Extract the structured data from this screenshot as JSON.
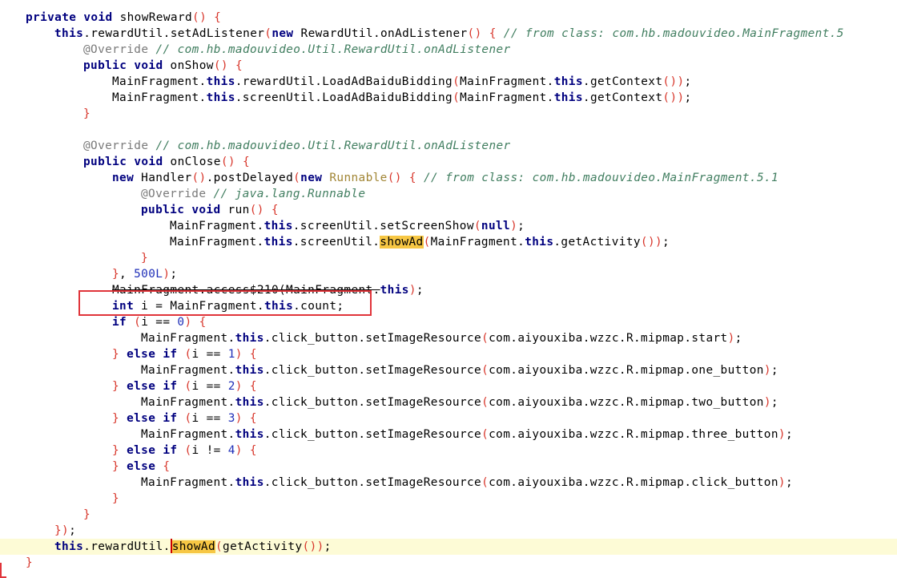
{
  "editor": {
    "lines": [
      [
        [
          "kw",
          "private"
        ],
        [
          "t",
          " "
        ],
        [
          "kw",
          "void"
        ],
        [
          "t",
          " showReward"
        ],
        [
          "p",
          "("
        ],
        [
          "p",
          ")"
        ],
        [
          "t",
          " "
        ],
        [
          "p",
          "{"
        ]
      ],
      [
        [
          "kw",
          "this"
        ],
        [
          "t",
          ".rewardUtil.setAdListener"
        ],
        [
          "p",
          "("
        ],
        [
          "kw",
          "new"
        ],
        [
          "t",
          " RewardUtil.onAdListener"
        ],
        [
          "p",
          "("
        ],
        [
          "p",
          ")"
        ],
        [
          "t",
          " "
        ],
        [
          "p",
          "{"
        ],
        [
          "t",
          " "
        ],
        [
          "cm",
          "// from class: com.hb.madouvideo.MainFragment.5"
        ]
      ],
      [
        [
          "an",
          "@Override"
        ],
        [
          "t",
          " "
        ],
        [
          "cm",
          "// com.hb.madouvideo.Util.RewardUtil.onAdListener"
        ]
      ],
      [
        [
          "kw",
          "public"
        ],
        [
          "t",
          " "
        ],
        [
          "kw",
          "void"
        ],
        [
          "t",
          " onShow"
        ],
        [
          "p",
          "("
        ],
        [
          "p",
          ")"
        ],
        [
          "t",
          " "
        ],
        [
          "p",
          "{"
        ]
      ],
      [
        [
          "t",
          "MainFragment."
        ],
        [
          "kw",
          "this"
        ],
        [
          "t",
          ".rewardUtil.LoadAdBaiduBidding"
        ],
        [
          "p",
          "("
        ],
        [
          "t",
          "MainFragment."
        ],
        [
          "kw",
          "this"
        ],
        [
          "t",
          ".getContext"
        ],
        [
          "p",
          "("
        ],
        [
          "p",
          ")"
        ],
        [
          "p",
          ")"
        ],
        [
          "t",
          ";"
        ]
      ],
      [
        [
          "t",
          "MainFragment."
        ],
        [
          "kw",
          "this"
        ],
        [
          "t",
          ".screenUtil.LoadAdBaiduBidding"
        ],
        [
          "p",
          "("
        ],
        [
          "t",
          "MainFragment."
        ],
        [
          "kw",
          "this"
        ],
        [
          "t",
          ".getContext"
        ],
        [
          "p",
          "("
        ],
        [
          "p",
          ")"
        ],
        [
          "p",
          ")"
        ],
        [
          "t",
          ";"
        ]
      ],
      [
        [
          "p",
          "}"
        ]
      ],
      [],
      [
        [
          "an",
          "@Override"
        ],
        [
          "t",
          " "
        ],
        [
          "cm",
          "// com.hb.madouvideo.Util.RewardUtil.onAdListener"
        ]
      ],
      [
        [
          "kw",
          "public"
        ],
        [
          "t",
          " "
        ],
        [
          "kw",
          "void"
        ],
        [
          "t",
          " onClose"
        ],
        [
          "p",
          "("
        ],
        [
          "p",
          ")"
        ],
        [
          "t",
          " "
        ],
        [
          "p",
          "{"
        ]
      ],
      [
        [
          "kw",
          "new"
        ],
        [
          "t",
          " Handler"
        ],
        [
          "p",
          "("
        ],
        [
          "p",
          ")"
        ],
        [
          "t",
          ".postDelayed"
        ],
        [
          "p",
          "("
        ],
        [
          "kw",
          "new"
        ],
        [
          "t",
          " "
        ],
        [
          "dq",
          "Runnable"
        ],
        [
          "p",
          "("
        ],
        [
          "p",
          ")"
        ],
        [
          "t",
          " "
        ],
        [
          "p",
          "{"
        ],
        [
          "t",
          " "
        ],
        [
          "cm",
          "// from class: com.hb.madouvideo.MainFragment.5.1"
        ]
      ],
      [
        [
          "an",
          "@Override"
        ],
        [
          "t",
          " "
        ],
        [
          "cm",
          "// java.lang.Runnable"
        ]
      ],
      [
        [
          "kw",
          "public"
        ],
        [
          "t",
          " "
        ],
        [
          "kw",
          "void"
        ],
        [
          "t",
          " run"
        ],
        [
          "p",
          "("
        ],
        [
          "p",
          ")"
        ],
        [
          "t",
          " "
        ],
        [
          "p",
          "{"
        ]
      ],
      [
        [
          "t",
          "MainFragment."
        ],
        [
          "kw",
          "this"
        ],
        [
          "t",
          ".screenUtil.setScreenShow"
        ],
        [
          "p",
          "("
        ],
        [
          "kw",
          "null"
        ],
        [
          "p",
          ")"
        ],
        [
          "t",
          ";"
        ]
      ],
      [
        [
          "t",
          "MainFragment."
        ],
        [
          "kw",
          "this"
        ],
        [
          "t",
          ".screenUtil."
        ],
        [
          "hl",
          "showAd"
        ],
        [
          "p",
          "("
        ],
        [
          "t",
          "MainFragment."
        ],
        [
          "kw",
          "this"
        ],
        [
          "t",
          ".getActivity"
        ],
        [
          "p",
          "("
        ],
        [
          "p",
          ")"
        ],
        [
          "p",
          ")"
        ],
        [
          "t",
          ";"
        ]
      ],
      [
        [
          "p",
          "}"
        ]
      ],
      [
        [
          "p",
          "}"
        ],
        [
          "t",
          ", "
        ],
        [
          "num",
          "500L"
        ],
        [
          "p",
          ")"
        ],
        [
          "t",
          ";"
        ]
      ],
      [
        [
          "st",
          "MainFragment.access$210(MainFragment."
        ],
        [
          "kw",
          "this"
        ],
        [
          "p",
          ")"
        ],
        [
          "t",
          ";"
        ]
      ],
      [
        [
          "kw",
          "int"
        ],
        [
          "t",
          " i = MainFragment."
        ],
        [
          "kw",
          "this"
        ],
        [
          "t",
          ".count;"
        ]
      ],
      [
        [
          "kw",
          "if"
        ],
        [
          "t",
          " "
        ],
        [
          "p",
          "("
        ],
        [
          "t",
          "i == "
        ],
        [
          "num",
          "0"
        ],
        [
          "p",
          ")"
        ],
        [
          "t",
          " "
        ],
        [
          "p",
          "{"
        ]
      ],
      [
        [
          "t",
          "MainFragment."
        ],
        [
          "kw",
          "this"
        ],
        [
          "t",
          ".click_button.setImageResource"
        ],
        [
          "p",
          "("
        ],
        [
          "t",
          "com.aiyouxiba.wzzc.R.mipmap.start"
        ],
        [
          "p",
          ")"
        ],
        [
          "t",
          ";"
        ]
      ],
      [
        [
          "p",
          "}"
        ],
        [
          "t",
          " "
        ],
        [
          "kw",
          "else"
        ],
        [
          "t",
          " "
        ],
        [
          "kw",
          "if"
        ],
        [
          "t",
          " "
        ],
        [
          "p",
          "("
        ],
        [
          "t",
          "i == "
        ],
        [
          "num",
          "1"
        ],
        [
          "p",
          ")"
        ],
        [
          "t",
          " "
        ],
        [
          "p",
          "{"
        ]
      ],
      [
        [
          "t",
          "MainFragment."
        ],
        [
          "kw",
          "this"
        ],
        [
          "t",
          ".click_button.setImageResource"
        ],
        [
          "p",
          "("
        ],
        [
          "t",
          "com.aiyouxiba.wzzc.R.mipmap.one_button"
        ],
        [
          "p",
          ")"
        ],
        [
          "t",
          ";"
        ]
      ],
      [
        [
          "p",
          "}"
        ],
        [
          "t",
          " "
        ],
        [
          "kw",
          "else"
        ],
        [
          "t",
          " "
        ],
        [
          "kw",
          "if"
        ],
        [
          "t",
          " "
        ],
        [
          "p",
          "("
        ],
        [
          "t",
          "i == "
        ],
        [
          "num",
          "2"
        ],
        [
          "p",
          ")"
        ],
        [
          "t",
          " "
        ],
        [
          "p",
          "{"
        ]
      ],
      [
        [
          "t",
          "MainFragment."
        ],
        [
          "kw",
          "this"
        ],
        [
          "t",
          ".click_button.setImageResource"
        ],
        [
          "p",
          "("
        ],
        [
          "t",
          "com.aiyouxiba.wzzc.R.mipmap.two_button"
        ],
        [
          "p",
          ")"
        ],
        [
          "t",
          ";"
        ]
      ],
      [
        [
          "p",
          "}"
        ],
        [
          "t",
          " "
        ],
        [
          "kw",
          "else"
        ],
        [
          "t",
          " "
        ],
        [
          "kw",
          "if"
        ],
        [
          "t",
          " "
        ],
        [
          "p",
          "("
        ],
        [
          "t",
          "i == "
        ],
        [
          "num",
          "3"
        ],
        [
          "p",
          ")"
        ],
        [
          "t",
          " "
        ],
        [
          "p",
          "{"
        ]
      ],
      [
        [
          "t",
          "MainFragment."
        ],
        [
          "kw",
          "this"
        ],
        [
          "t",
          ".click_button.setImageResource"
        ],
        [
          "p",
          "("
        ],
        [
          "t",
          "com.aiyouxiba.wzzc.R.mipmap.three_button"
        ],
        [
          "p",
          ")"
        ],
        [
          "t",
          ";"
        ]
      ],
      [
        [
          "p",
          "}"
        ],
        [
          "t",
          " "
        ],
        [
          "kw",
          "else"
        ],
        [
          "t",
          " "
        ],
        [
          "kw",
          "if"
        ],
        [
          "t",
          " "
        ],
        [
          "p",
          "("
        ],
        [
          "t",
          "i != "
        ],
        [
          "num",
          "4"
        ],
        [
          "p",
          ")"
        ],
        [
          "t",
          " "
        ],
        [
          "p",
          "{"
        ]
      ],
      [
        [
          "p",
          "}"
        ],
        [
          "t",
          " "
        ],
        [
          "kw",
          "else"
        ],
        [
          "t",
          " "
        ],
        [
          "p",
          "{"
        ]
      ],
      [
        [
          "t",
          "MainFragment."
        ],
        [
          "kw",
          "this"
        ],
        [
          "t",
          ".click_button.setImageResource"
        ],
        [
          "p",
          "("
        ],
        [
          "t",
          "com.aiyouxiba.wzzc.R.mipmap.click_button"
        ],
        [
          "p",
          ")"
        ],
        [
          "t",
          ";"
        ]
      ],
      [
        [
          "p",
          "}"
        ]
      ],
      [
        [
          "p",
          "}"
        ]
      ],
      [
        [
          "p",
          "}"
        ],
        [
          "p",
          ")"
        ],
        [
          "t",
          ";"
        ]
      ],
      [
        [
          "kw",
          "this"
        ],
        [
          "t",
          ".rewardUtil."
        ],
        [
          "caret",
          ""
        ],
        [
          "hl",
          "showAd"
        ],
        [
          "p",
          "("
        ],
        [
          "t",
          "getActivity"
        ],
        [
          "p",
          "("
        ],
        [
          "p",
          ")"
        ],
        [
          "p",
          ")"
        ],
        [
          "t",
          ";"
        ]
      ],
      [
        [
          "p",
          "}"
        ]
      ]
    ],
    "current_line": 33,
    "highlight_color": "#f7c744",
    "annotation_box_color": "#e0343a"
  }
}
